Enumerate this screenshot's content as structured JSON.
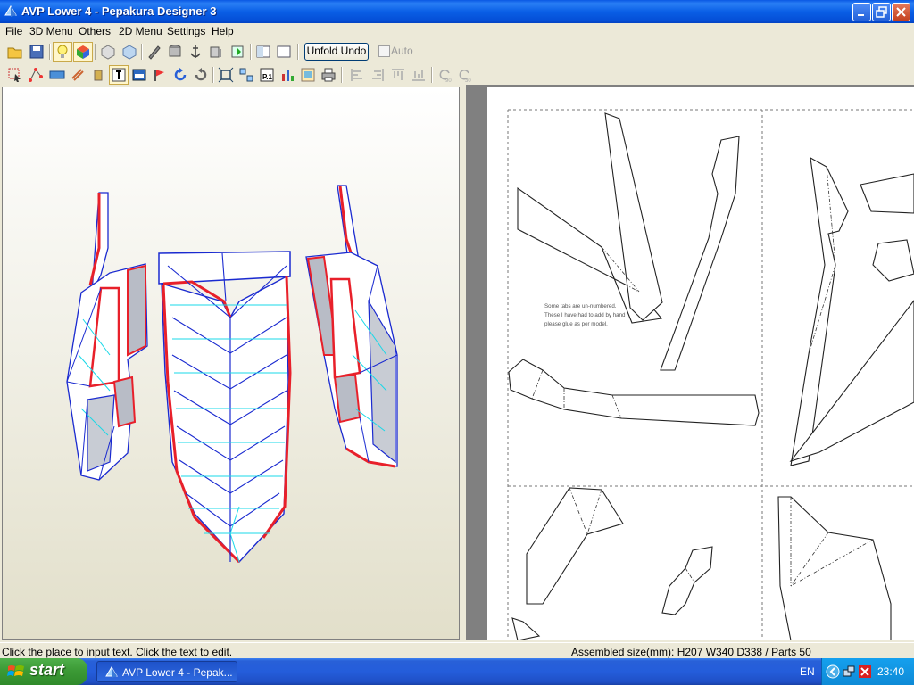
{
  "window": {
    "title": "AVP Lower 4 - Pepakura Designer 3"
  },
  "menu": [
    "File",
    "3D Menu",
    "Others",
    "2D Menu",
    "Settings",
    "Help"
  ],
  "toolbar": {
    "unfold_undo_label": "Unfold Undo",
    "auto_label": "Auto"
  },
  "paper": {
    "note_lines": [
      "Some tabs are un-numbered.",
      "These I have had to add by hand",
      "please glue as per model."
    ]
  },
  "status": {
    "hint": "Click the place to input text. Click the text to edit.",
    "assembled": "Assembled size(mm): H207 W340 D338 / Parts 50"
  },
  "taskbar": {
    "start_label": "start",
    "task_label": "AVP Lower 4 - Pepak...",
    "language": "EN",
    "clock": "23:40"
  },
  "colors": {
    "titlebar": "#0a5fe6",
    "taskbar": "#245ddb",
    "start": "#3c9a36",
    "edge_red": "#e8202a",
    "edge_blue": "#1a2ad0",
    "fold_cyan": "#18d8e8"
  }
}
